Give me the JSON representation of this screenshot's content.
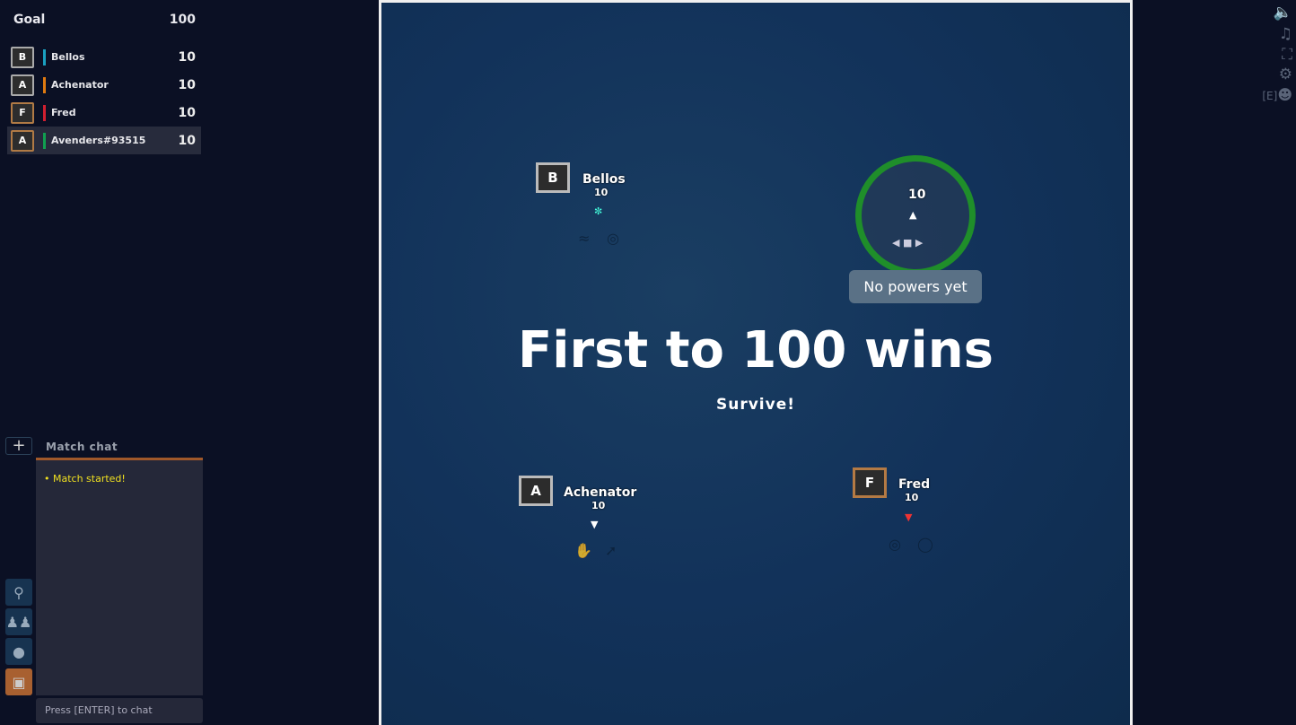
{
  "goal": {
    "label": "Goal",
    "value": "100"
  },
  "leaderboard": [
    {
      "initial": "B",
      "name": "Bellos",
      "score": "10",
      "color": "#1aa0c0",
      "frame": "silver"
    },
    {
      "initial": "A",
      "name": "Achenator",
      "score": "10",
      "color": "#e07a10",
      "frame": "silver"
    },
    {
      "initial": "F",
      "name": "Fred",
      "score": "10",
      "color": "#d02030",
      "frame": "bronze"
    },
    {
      "initial": "A",
      "name": "Avenders#93515",
      "score": "10",
      "color": "#10a050",
      "frame": "bronze",
      "is_self": true
    }
  ],
  "chat": {
    "title": "Match chat",
    "add_label": "+",
    "messages": [
      "• Match started!"
    ],
    "input_placeholder": "Press [ENTER] to chat"
  },
  "sidebar_icons": [
    "search-icon",
    "friends-icon",
    "globe-icon",
    "gamepad-icon"
  ],
  "game": {
    "title": "First to 100 wins",
    "subtitle": "Survive!",
    "self": {
      "score": "10",
      "tooltip": "No powers yet"
    },
    "players": [
      {
        "initial": "B",
        "name": "Bellos",
        "score": "10"
      },
      {
        "initial": "A",
        "name": "Achenator",
        "score": "10"
      },
      {
        "initial": "F",
        "name": "Fred",
        "score": "10"
      }
    ]
  },
  "top_right": {
    "emote_key": "[E]",
    "icons": [
      "volume-icon",
      "music-icon",
      "fullscreen-icon",
      "settings-icon",
      "emote-icon"
    ]
  }
}
